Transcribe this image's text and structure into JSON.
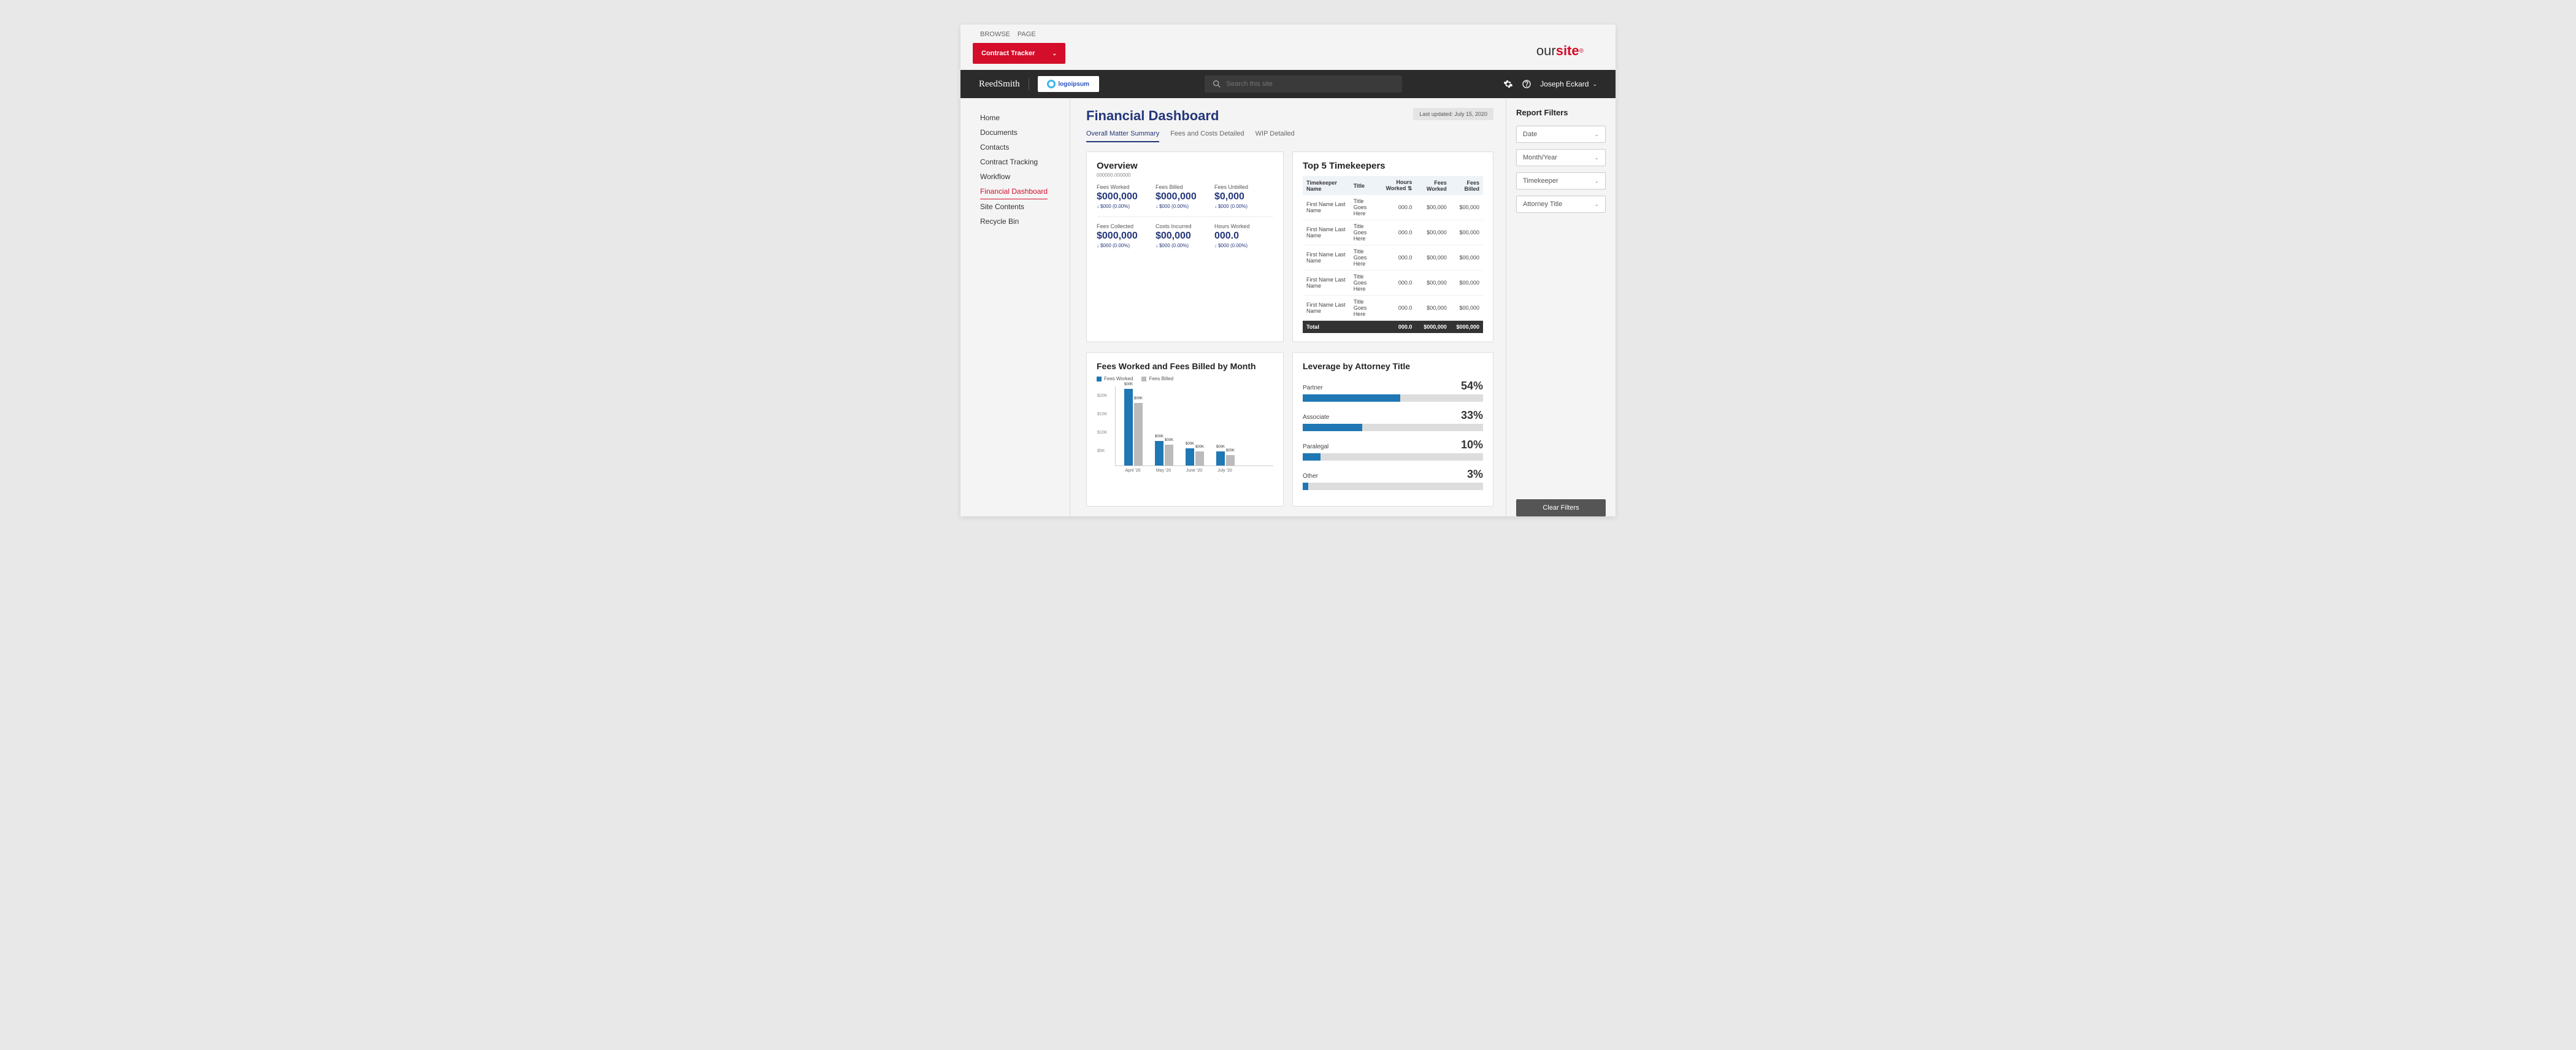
{
  "ribbon": {
    "browse": "BROWSE",
    "page": "PAGE"
  },
  "tracker_button": "Contract Tracker",
  "brand": {
    "our": "our",
    "site": "site"
  },
  "reed": "ReedSmith",
  "logo_text": "logoipsum",
  "search": {
    "placeholder": "Search this site"
  },
  "user": {
    "name": "Joseph Eckard"
  },
  "sidenav": [
    {
      "label": "Home",
      "active": false
    },
    {
      "label": "Documents",
      "active": false
    },
    {
      "label": "Contacts",
      "active": false
    },
    {
      "label": "Contract Tracking",
      "active": false
    },
    {
      "label": "Workflow",
      "active": false
    },
    {
      "label": "Financial Dashboard",
      "active": true
    },
    {
      "label": "Site Contents",
      "active": false
    },
    {
      "label": "Recycle Bin",
      "active": false
    }
  ],
  "page_title": "Financial Dashboard",
  "last_updated": "Last updated: July 15, 2020",
  "tabs": [
    {
      "label": "Overall Matter Summary",
      "active": true
    },
    {
      "label": "Fees and Costs Detailed",
      "active": false
    },
    {
      "label": "WIP Detailed",
      "active": false
    }
  ],
  "overview": {
    "title": "Overview",
    "subtitle": "000000.000000",
    "row1": [
      {
        "label": "Fees Worked",
        "value": "$000,000",
        "delta": "$000 (0.00%)"
      },
      {
        "label": "Fees Billed",
        "value": "$000,000",
        "delta": "$000 (0.00%)"
      },
      {
        "label": "Fees Unbilled",
        "value": "$0,000",
        "delta": "$000 (0.00%)"
      }
    ],
    "row2": [
      {
        "label": "Fees Collected",
        "value": "$000,000",
        "delta": "$000 (0.00%)"
      },
      {
        "label": "Costs Incurred",
        "value": "$00,000",
        "delta": "$000 (0.00%)"
      },
      {
        "label": "Hours Worked",
        "value": "000.0",
        "delta": "$000 (0.00%)"
      }
    ]
  },
  "timekeepers": {
    "title": "Top 5 Timekeepers",
    "headers": [
      "Timekeeper Name",
      "Title",
      "Hours Worked",
      "Fees Worked",
      "Fees Billed"
    ],
    "rows": [
      {
        "name": "First Name Last Name",
        "title": "Title Goes Here",
        "hours": "000.0",
        "worked": "$00,000",
        "billed": "$00,000"
      },
      {
        "name": "First Name Last Name",
        "title": "Title Goes Here",
        "hours": "000.0",
        "worked": "$00,000",
        "billed": "$00,000"
      },
      {
        "name": "First Name Last Name",
        "title": "Title Goes Here",
        "hours": "000.0",
        "worked": "$00,000",
        "billed": "$00,000"
      },
      {
        "name": "First Name Last Name",
        "title": "Title Goes Here",
        "hours": "000.0",
        "worked": "$00,000",
        "billed": "$00,000"
      },
      {
        "name": "First Name Last Name",
        "title": "Title Goes Here",
        "hours": "000.0",
        "worked": "$00,000",
        "billed": "$00,000"
      }
    ],
    "total": {
      "label": "Total",
      "hours": "000.0",
      "worked": "$000,000",
      "billed": "$000,000"
    }
  },
  "chart_data": [
    {
      "type": "bar",
      "title": "Fees Worked and Fees Billed by Month",
      "legend": [
        "Fees Worked",
        "Fees Billed"
      ],
      "categories": [
        "April '20",
        "May '20",
        "June '20",
        "July '20"
      ],
      "series": [
        {
          "name": "Fees Worked",
          "values": [
            22000,
            7000,
            5000,
            4000
          ],
          "color": "#1f77b4",
          "labels": [
            "$00K",
            "$00K",
            "$00K",
            "$00K"
          ]
        },
        {
          "name": "Fees Billed",
          "values": [
            18000,
            6000,
            4000,
            3000
          ],
          "color": "#bbbbbb",
          "labels": [
            "$00K",
            "$00K",
            "$00K",
            "$00K"
          ]
        }
      ],
      "yticks": [
        "$20K",
        "$15K",
        "$10K",
        "$5K"
      ],
      "ylim": [
        0,
        22000
      ]
    },
    {
      "type": "bar",
      "title": "Leverage by Attorney Title",
      "categories": [
        "Partner",
        "Associate",
        "Paralegal",
        "Other"
      ],
      "values": [
        54,
        33,
        10,
        3
      ],
      "unit": "%"
    }
  ],
  "filters": {
    "title": "Report Filters",
    "items": [
      "Date",
      "Month/Year",
      "Timekeeper",
      "Attorney Title"
    ],
    "clear": "Clear Filters"
  }
}
